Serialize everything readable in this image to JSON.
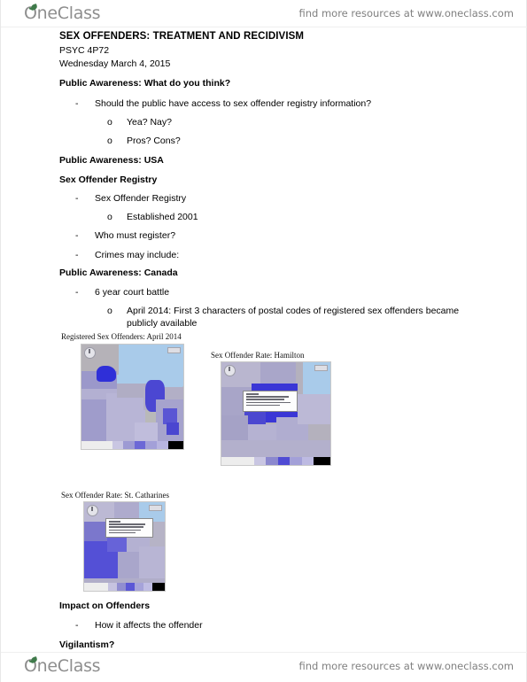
{
  "watermark": {
    "brand": "OneClass",
    "tagline": "find more resources at www.oneclass.com"
  },
  "document": {
    "title": "SEX OFFENDERS: TREATMENT AND RECIDIVISM",
    "course_code": "PSYC 4P72",
    "date": "Wednesday March 4, 2015",
    "sections": [
      {
        "heading": "Public Awareness: What do you think?",
        "items": [
          {
            "level": 1,
            "text": "Should the public have access to sex offender registry information?"
          },
          {
            "level": 2,
            "text": "Yea? Nay?"
          },
          {
            "level": 2,
            "text": "Pros? Cons?"
          }
        ]
      },
      {
        "heading": "Public Awareness: USA",
        "items": []
      },
      {
        "heading": "Sex Offender Registry",
        "items": [
          {
            "level": 1,
            "text": "Sex Offender Registry"
          },
          {
            "level": 2,
            "text": "Established 2001"
          },
          {
            "level": 1,
            "text": "Who must register?"
          },
          {
            "level": 1,
            "text": "Crimes may include:"
          }
        ]
      },
      {
        "heading": "Public Awareness: Canada",
        "items": [
          {
            "level": 1,
            "text": "6 year court battle"
          },
          {
            "level": 2,
            "text": "April 2014: First 3 characters of postal codes of registered sex offenders became",
            "continuation": "publicly available"
          }
        ]
      },
      {
        "heading": "Impact on Offenders",
        "items": [
          {
            "level": 1,
            "text": "How it affects the offender"
          }
        ]
      },
      {
        "heading": "Vigilantism?",
        "items": []
      }
    ],
    "figures": [
      {
        "caption": "Registered Sex Offenders: April 2014"
      },
      {
        "caption": "Sex Offender Rate: Hamilton"
      },
      {
        "caption": "Sex Offender Rate: St. Catharines"
      }
    ]
  },
  "bullets": {
    "dash": "-",
    "circle": "o"
  },
  "colors": {
    "water": "#a9cbea",
    "land": "#b5b2b8",
    "choropleth_low": "#c5c3d4",
    "choropleth_mid": "#9a97cf",
    "choropleth_high": "#6f6bd4",
    "choropleth_max": "#2f2fd8",
    "legend_bar": "#000000"
  }
}
